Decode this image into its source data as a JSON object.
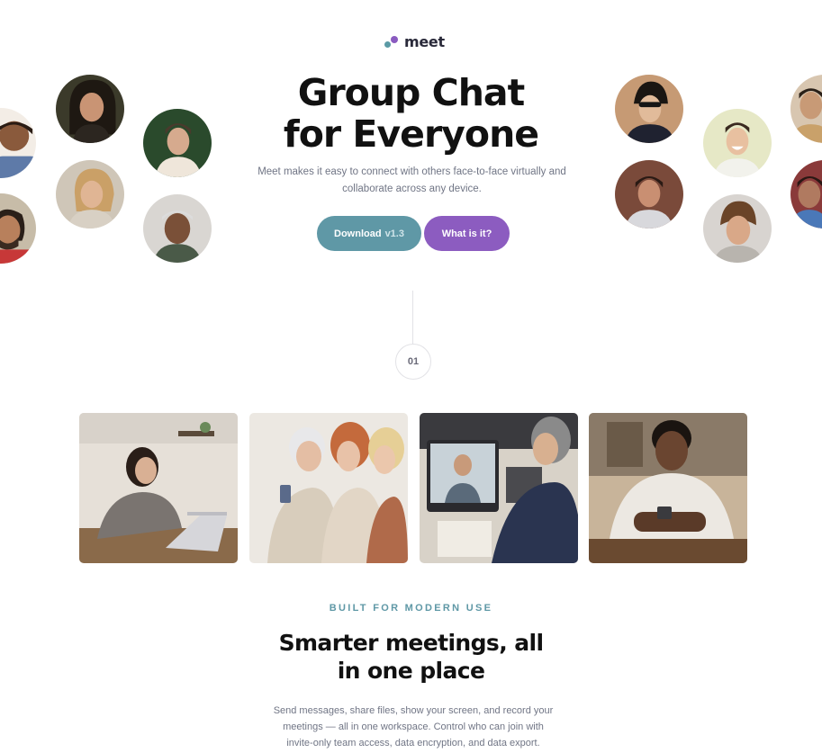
{
  "brand": {
    "name": "meet",
    "accent_teal": "#5f98a6",
    "accent_purple": "#8c5cc0"
  },
  "hero": {
    "title_line1": "Group Chat",
    "title_line2": "for Everyone",
    "subtitle": "Meet makes it easy to connect with others face-to-face virtually and collaborate across any device.",
    "download_label": "Download",
    "download_version": "v1.3",
    "what_label": "What is it?"
  },
  "step": {
    "number": "01"
  },
  "features": {
    "eyebrow": "BUILT FOR MODERN USE",
    "title_line1": "Smarter meetings, all",
    "title_line2": "in one place",
    "body": "Send messages, share files, show your screen, and record your meetings — all in one workspace. Control who can join with invite-only team access, data encryption, and data export."
  },
  "icons": [
    "meet-logo-icon"
  ]
}
